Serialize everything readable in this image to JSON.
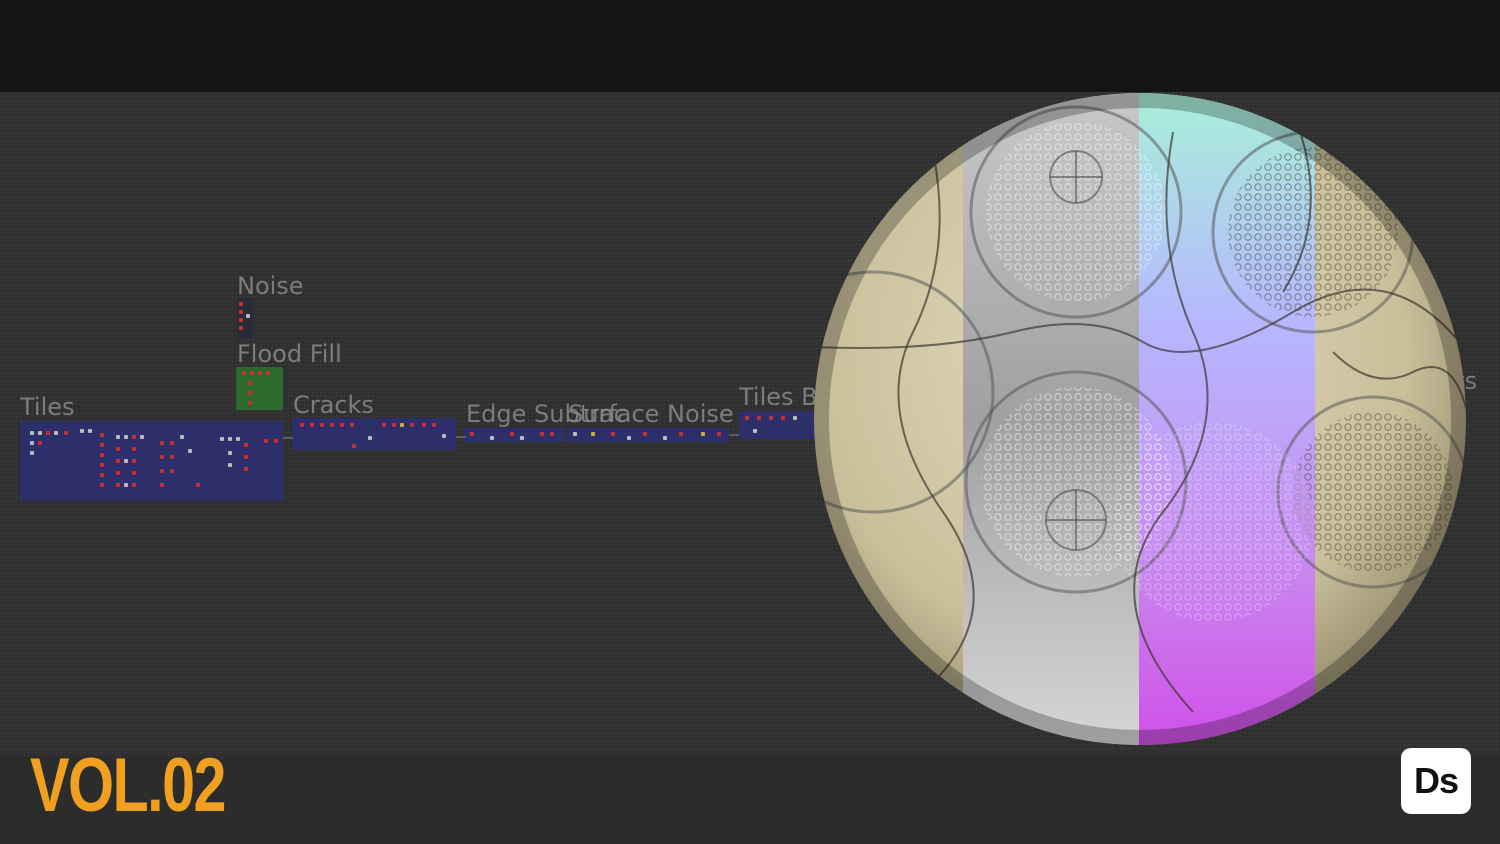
{
  "graph": {
    "frames": [
      {
        "id": "noise",
        "label": "Noise"
      },
      {
        "id": "flood-fill",
        "label": "Flood Fill"
      },
      {
        "id": "tiles",
        "label": "Tiles"
      },
      {
        "id": "cracks",
        "label": "Cracks"
      },
      {
        "id": "edge-subtract",
        "label": "Edge Subtrac"
      },
      {
        "id": "surface-noise",
        "label": "Surface Noise"
      },
      {
        "id": "tiles-b",
        "label": "Tiles B"
      },
      {
        "id": "outputs",
        "label": "uts"
      }
    ]
  },
  "footer": {
    "volume_label": "VOL.02",
    "app_badge": "Ds"
  },
  "colors": {
    "accent": "#f0a020",
    "frame_blue": "#2d2f6b",
    "frame_green": "#2e6a2e",
    "badge_bg": "#ffffff"
  },
  "icons": {
    "app_badge_icon": "designer-app-icon"
  }
}
